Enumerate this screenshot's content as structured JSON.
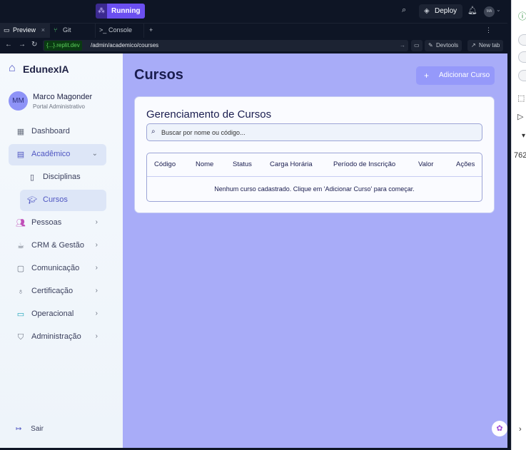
{
  "topbar": {
    "run_label": "Running",
    "deploy_label": "Deploy",
    "avatar_initials": "MA"
  },
  "tabs": [
    {
      "label": "Preview"
    },
    {
      "label": "Git"
    },
    {
      "label": "Console"
    }
  ],
  "address": {
    "host": "{...}.replit.dev",
    "path": "/admin/academico/courses",
    "devtools_label": "Devtools",
    "newtab_label": "New tab"
  },
  "sidebar": {
    "brand": "EdunexIA",
    "user": {
      "initials": "MM",
      "name": "Marco Magonder",
      "role": "Portal Administrativo"
    },
    "items": [
      {
        "label": "Dashboard"
      },
      {
        "label": "Acadêmico"
      },
      {
        "label": "Disciplinas"
      },
      {
        "label": "Cursos"
      },
      {
        "label": "Pessoas"
      },
      {
        "label": "CRM & Gestão"
      },
      {
        "label": "Comunicação"
      },
      {
        "label": "Certificação"
      },
      {
        "label": "Operacional"
      },
      {
        "label": "Administração"
      }
    ],
    "logout_label": "Sair"
  },
  "main": {
    "title": "Cursos",
    "add_button": "Adicionar Curso",
    "card_title": "Gerenciamento de Cursos",
    "search_placeholder": "Buscar por nome ou código...",
    "columns": [
      "Código",
      "Nome",
      "Status",
      "Carga Horária",
      "Período de Inscrição",
      "Valor",
      "Ações"
    ],
    "empty_message": "Nenhum curso cadastrado. Clique em 'Adicionar Curso' para começar."
  },
  "right_panel": {
    "number_text": "762"
  },
  "colors": {
    "accent": "#4f56c2",
    "content_bg": "#a8acf8",
    "run_button": "#6b4ff0"
  }
}
